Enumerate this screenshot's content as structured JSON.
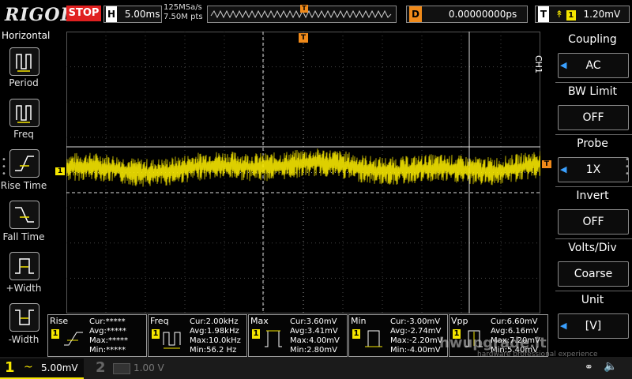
{
  "brand": "RIGOL",
  "run_state": "STOP",
  "timebase": {
    "key": "H",
    "value": "5.00ms"
  },
  "acquisition": {
    "sample_rate": "125MSa/s",
    "memory": "7.50M pts"
  },
  "trigger_marker": "T",
  "delay": {
    "key": "D",
    "value": "0.00000000ps"
  },
  "trigger": {
    "key": "T",
    "channel": "1",
    "level": "1.20mV"
  },
  "horizontal_menu": {
    "title": "Horizontal",
    "items": [
      "Period",
      "Freq",
      "Rise Time",
      "Fall Time",
      "+Width",
      "-Width"
    ]
  },
  "ch1_marker": "1",
  "ch1_side_label": "CH1",
  "channel_menu": [
    {
      "title": "Coupling",
      "value": "AC",
      "arrow": "◀"
    },
    {
      "title": "BW Limit",
      "value": "OFF",
      "arrow": ""
    },
    {
      "title": "Probe",
      "value": "1X",
      "arrow": "◀"
    },
    {
      "title": "Invert",
      "value": "OFF",
      "arrow": ""
    },
    {
      "title": "Volts/Div",
      "value": "Coarse",
      "arrow": ""
    },
    {
      "title": "Unit",
      "value": "[V]",
      "arrow": "◀"
    }
  ],
  "measurements": [
    {
      "name": "Rise",
      "ch": "1",
      "cur": "Cur:*****",
      "avg": "Avg:*****",
      "max": "Max:*****",
      "min": "Min:*****"
    },
    {
      "name": "Freq",
      "ch": "1",
      "cur": "Cur:2.00kHz",
      "avg": "Avg:1.98kHz",
      "max": "Max:10.0kHz",
      "min": "Min:56.2 Hz"
    },
    {
      "name": "Max",
      "ch": "1",
      "cur": "Cur:3.60mV",
      "avg": "Avg:3.41mV",
      "max": "Max:4.00mV",
      "min": "Min:2.80mV"
    },
    {
      "name": "Min",
      "ch": "1",
      "cur": "Cur:-3.00mV",
      "avg": "Avg:-2.74mV",
      "max": "Max:-2.20mV",
      "min": "Min:-4.00mV"
    },
    {
      "name": "Vpp",
      "ch": "1",
      "cur": "Cur:6.60mV",
      "avg": "Avg:6.16mV",
      "max": "Max:7.20mV",
      "min": "Min:5.40mV"
    }
  ],
  "channels": [
    {
      "num": "1",
      "coupling": "~",
      "scale": "5.00mV"
    },
    {
      "num": "2",
      "coupling": "",
      "scale": "1.00 V"
    }
  ],
  "watermark": {
    "title": "hwupgrade.it",
    "sub": "hardware professional experience"
  },
  "colors": {
    "ch1": "#f5e600",
    "trigger": "#f08a1a",
    "stop": "#e02020"
  }
}
